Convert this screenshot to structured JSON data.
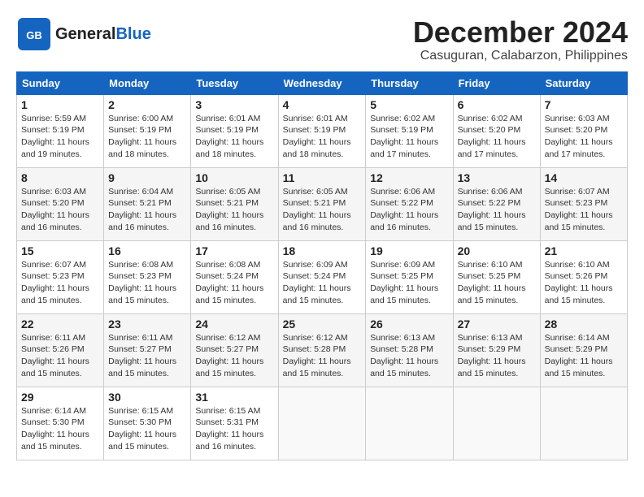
{
  "header": {
    "logo_general": "General",
    "logo_blue": "Blue",
    "month": "December 2024",
    "location": "Casuguran, Calabarzon, Philippines"
  },
  "weekdays": [
    "Sunday",
    "Monday",
    "Tuesday",
    "Wednesday",
    "Thursday",
    "Friday",
    "Saturday"
  ],
  "weeks": [
    [
      {
        "day": "1",
        "sunrise": "5:59 AM",
        "sunset": "5:19 PM",
        "daylight": "11 hours and 19 minutes."
      },
      {
        "day": "2",
        "sunrise": "6:00 AM",
        "sunset": "5:19 PM",
        "daylight": "11 hours and 18 minutes."
      },
      {
        "day": "3",
        "sunrise": "6:01 AM",
        "sunset": "5:19 PM",
        "daylight": "11 hours and 18 minutes."
      },
      {
        "day": "4",
        "sunrise": "6:01 AM",
        "sunset": "5:19 PM",
        "daylight": "11 hours and 18 minutes."
      },
      {
        "day": "5",
        "sunrise": "6:02 AM",
        "sunset": "5:19 PM",
        "daylight": "11 hours and 17 minutes."
      },
      {
        "day": "6",
        "sunrise": "6:02 AM",
        "sunset": "5:20 PM",
        "daylight": "11 hours and 17 minutes."
      },
      {
        "day": "7",
        "sunrise": "6:03 AM",
        "sunset": "5:20 PM",
        "daylight": "11 hours and 17 minutes."
      }
    ],
    [
      {
        "day": "8",
        "sunrise": "6:03 AM",
        "sunset": "5:20 PM",
        "daylight": "11 hours and 16 minutes."
      },
      {
        "day": "9",
        "sunrise": "6:04 AM",
        "sunset": "5:21 PM",
        "daylight": "11 hours and 16 minutes."
      },
      {
        "day": "10",
        "sunrise": "6:05 AM",
        "sunset": "5:21 PM",
        "daylight": "11 hours and 16 minutes."
      },
      {
        "day": "11",
        "sunrise": "6:05 AM",
        "sunset": "5:21 PM",
        "daylight": "11 hours and 16 minutes."
      },
      {
        "day": "12",
        "sunrise": "6:06 AM",
        "sunset": "5:22 PM",
        "daylight": "11 hours and 16 minutes."
      },
      {
        "day": "13",
        "sunrise": "6:06 AM",
        "sunset": "5:22 PM",
        "daylight": "11 hours and 15 minutes."
      },
      {
        "day": "14",
        "sunrise": "6:07 AM",
        "sunset": "5:23 PM",
        "daylight": "11 hours and 15 minutes."
      }
    ],
    [
      {
        "day": "15",
        "sunrise": "6:07 AM",
        "sunset": "5:23 PM",
        "daylight": "11 hours and 15 minutes."
      },
      {
        "day": "16",
        "sunrise": "6:08 AM",
        "sunset": "5:23 PM",
        "daylight": "11 hours and 15 minutes."
      },
      {
        "day": "17",
        "sunrise": "6:08 AM",
        "sunset": "5:24 PM",
        "daylight": "11 hours and 15 minutes."
      },
      {
        "day": "18",
        "sunrise": "6:09 AM",
        "sunset": "5:24 PM",
        "daylight": "11 hours and 15 minutes."
      },
      {
        "day": "19",
        "sunrise": "6:09 AM",
        "sunset": "5:25 PM",
        "daylight": "11 hours and 15 minutes."
      },
      {
        "day": "20",
        "sunrise": "6:10 AM",
        "sunset": "5:25 PM",
        "daylight": "11 hours and 15 minutes."
      },
      {
        "day": "21",
        "sunrise": "6:10 AM",
        "sunset": "5:26 PM",
        "daylight": "11 hours and 15 minutes."
      }
    ],
    [
      {
        "day": "22",
        "sunrise": "6:11 AM",
        "sunset": "5:26 PM",
        "daylight": "11 hours and 15 minutes."
      },
      {
        "day": "23",
        "sunrise": "6:11 AM",
        "sunset": "5:27 PM",
        "daylight": "11 hours and 15 minutes."
      },
      {
        "day": "24",
        "sunrise": "6:12 AM",
        "sunset": "5:27 PM",
        "daylight": "11 hours and 15 minutes."
      },
      {
        "day": "25",
        "sunrise": "6:12 AM",
        "sunset": "5:28 PM",
        "daylight": "11 hours and 15 minutes."
      },
      {
        "day": "26",
        "sunrise": "6:13 AM",
        "sunset": "5:28 PM",
        "daylight": "11 hours and 15 minutes."
      },
      {
        "day": "27",
        "sunrise": "6:13 AM",
        "sunset": "5:29 PM",
        "daylight": "11 hours and 15 minutes."
      },
      {
        "day": "28",
        "sunrise": "6:14 AM",
        "sunset": "5:29 PM",
        "daylight": "11 hours and 15 minutes."
      }
    ],
    [
      {
        "day": "29",
        "sunrise": "6:14 AM",
        "sunset": "5:30 PM",
        "daylight": "11 hours and 15 minutes."
      },
      {
        "day": "30",
        "sunrise": "6:15 AM",
        "sunset": "5:30 PM",
        "daylight": "11 hours and 15 minutes."
      },
      {
        "day": "31",
        "sunrise": "6:15 AM",
        "sunset": "5:31 PM",
        "daylight": "11 hours and 16 minutes."
      },
      null,
      null,
      null,
      null
    ]
  ]
}
